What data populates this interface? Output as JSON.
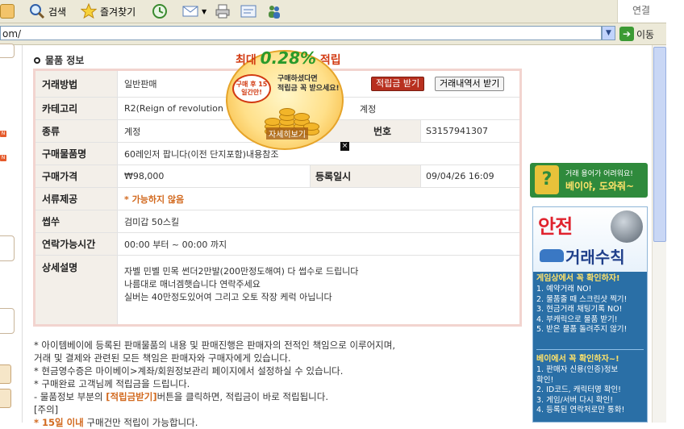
{
  "toolbar": {
    "search_label": "검색",
    "favorites_label": "즐겨찾기",
    "right_label": "연결"
  },
  "addressbar": {
    "url": "om/",
    "go_label": "이동"
  },
  "section": {
    "title": "물품 정보"
  },
  "info": {
    "trade_method_label": "거래방법",
    "trade_method_value": "일반판매",
    "btn_points": "적립금 받기",
    "btn_history": "거래내역서 받기",
    "category_label": "카테고리",
    "category_value": "R2(Reign of revolution",
    "category_suffix": "계정",
    "type_label": "종류",
    "type_value": "계정",
    "number_label": "번호",
    "number_value": "S3157941307",
    "item_name_label": "구매물품명",
    "item_name_value": "60레인저 팝니다(이전 단지포함)내용참조",
    "price_label": "구매가격",
    "price_value": "₩98,000",
    "reg_date_label": "등록일시",
    "reg_date_value": "09/04/26 16:09",
    "docs_label": "서류제공",
    "docs_value": "* 가능하지 않음",
    "server_label": "썹쑤",
    "server_value": "검미갑 50스킬",
    "contact_label": "연락가능시간",
    "contact_value": "00:00 부터 ~ 00:00 까지",
    "detail_label": "상세설명",
    "detail_lines": [
      "자벨 민벨 민목 썬더2만발(200만정도해여) 다 썹수로 드립니다",
      "나름대로 매너겜햇습니다 연락주세요",
      "실버는 40만정도있어여 그리고 오토 작장 케럭 아닙니다"
    ]
  },
  "notice": {
    "line1": "* 아이템베이에 등록된 판매물품의 내용 및 판매진행은 판매자의 전적인 책임으로 이루어지며,",
    "line2": "거래 및 결제와 관련된 모든 책임은 판매자와 구매자에게 있습니다.",
    "line3": "* 현금영수증은 마이베이>계좌/회원정보관리 페이지에서 설정하실 수 있습니다.",
    "line4": "* 구매완료 고객님께 적립금을 드립니다.",
    "line5_pre": "- 물품정보 부분의 ",
    "line5_hl": "[적립금받기]",
    "line5_post": "버튼을 클릭하면, 적립금이 바로 적립됩니다.",
    "line6": "[주의]",
    "line7_hl": "* 15일 이내",
    "line7_post": " 구매건만 적립이 가능합니다."
  },
  "popup": {
    "title_pre": "최대",
    "title_big": "0.28%",
    "title_post": "적립",
    "stamp": "구매 후 15일간만!",
    "text1": "구매하셨다면",
    "text2": "적립금 꼭 받으세요!",
    "more": "자세히보기",
    "close": "×"
  },
  "sidebar": {
    "help_line1": "거래 용어가 어려워요!",
    "help_line2": "베이야, 도와줘~",
    "safe_title_a": "안전",
    "safe_title_b": "거래수칙",
    "sec1_title": "게임상에서 꼭 확인하자!",
    "sec1_items": [
      "1. 예약거래 NO!",
      "2. 물품줄 때 스크린샷 찍기!",
      "3. 현금거래 채팅기록 NO!",
      "4. 부캐릭으로 물품 받기!",
      "5. 받은 물품 돌려주지 않기!"
    ],
    "sec2_title": "베이에서 꼭 확인하자~!",
    "sec2_items": [
      "1. 판매자 신용(인증)정보",
      "   확인!",
      "2. ID코드, 캐릭터명 확인!",
      "3. 게임/서버 다시 확인!",
      "4. 등록된 연락처로만 통화!"
    ]
  },
  "colors": {
    "label_bg": "#f3efe9",
    "table_border": "#f2d4cf",
    "accent_orange": "#d2691e",
    "points_button": "#b8301f",
    "help_green": "#2f8a3c",
    "safe_blue": "#2a6fa6"
  }
}
